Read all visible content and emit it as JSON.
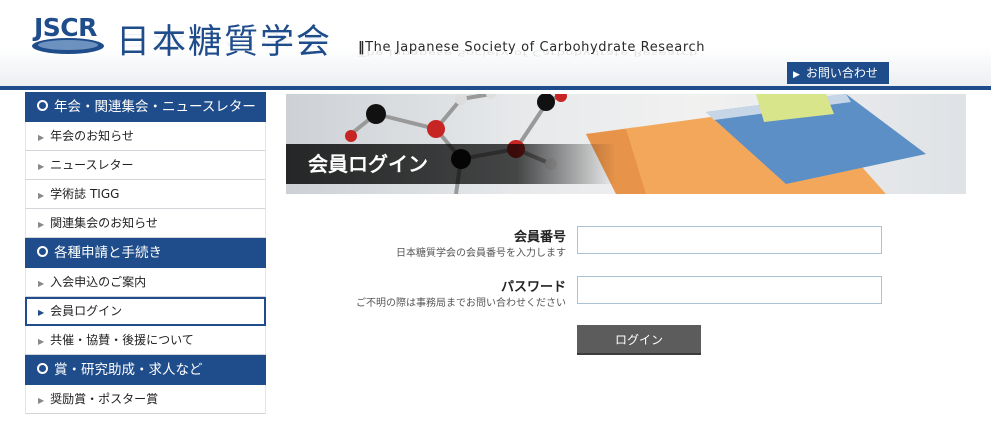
{
  "header": {
    "logo_text": "JSCR",
    "site_title": "日本糖質学会",
    "site_title_en": "The Japanese Society of Carbohydrate Research",
    "contact_label": "お問い合わせ"
  },
  "sidebar": {
    "sections": [
      {
        "title": "年会・関連集会・ニュースレター",
        "items": [
          {
            "label": "年会のお知らせ"
          },
          {
            "label": "ニュースレター"
          },
          {
            "label": "学術誌 TIGG"
          },
          {
            "label": "関連集会のお知らせ"
          }
        ]
      },
      {
        "title": "各種申請と手続き",
        "items": [
          {
            "label": "入会申込のご案内"
          },
          {
            "label": "会員ログイン",
            "active": true
          },
          {
            "label": "共催・協賛・後援について"
          }
        ]
      },
      {
        "title": "賞・研究助成・求人など",
        "items": [
          {
            "label": "奨励賞・ポスター賞"
          }
        ]
      }
    ]
  },
  "banner": {
    "title": "会員ログイン"
  },
  "form": {
    "member_id": {
      "label": "会員番号",
      "hint": "日本糖質学会の会員番号を入力します",
      "value": ""
    },
    "password": {
      "label": "パスワード",
      "hint": "ご不明の際は事務局までお問い合わせください",
      "value": ""
    },
    "submit_label": "ログイン"
  },
  "colors": {
    "brand": "#1f4c8a",
    "button": "#5c5c5c"
  }
}
